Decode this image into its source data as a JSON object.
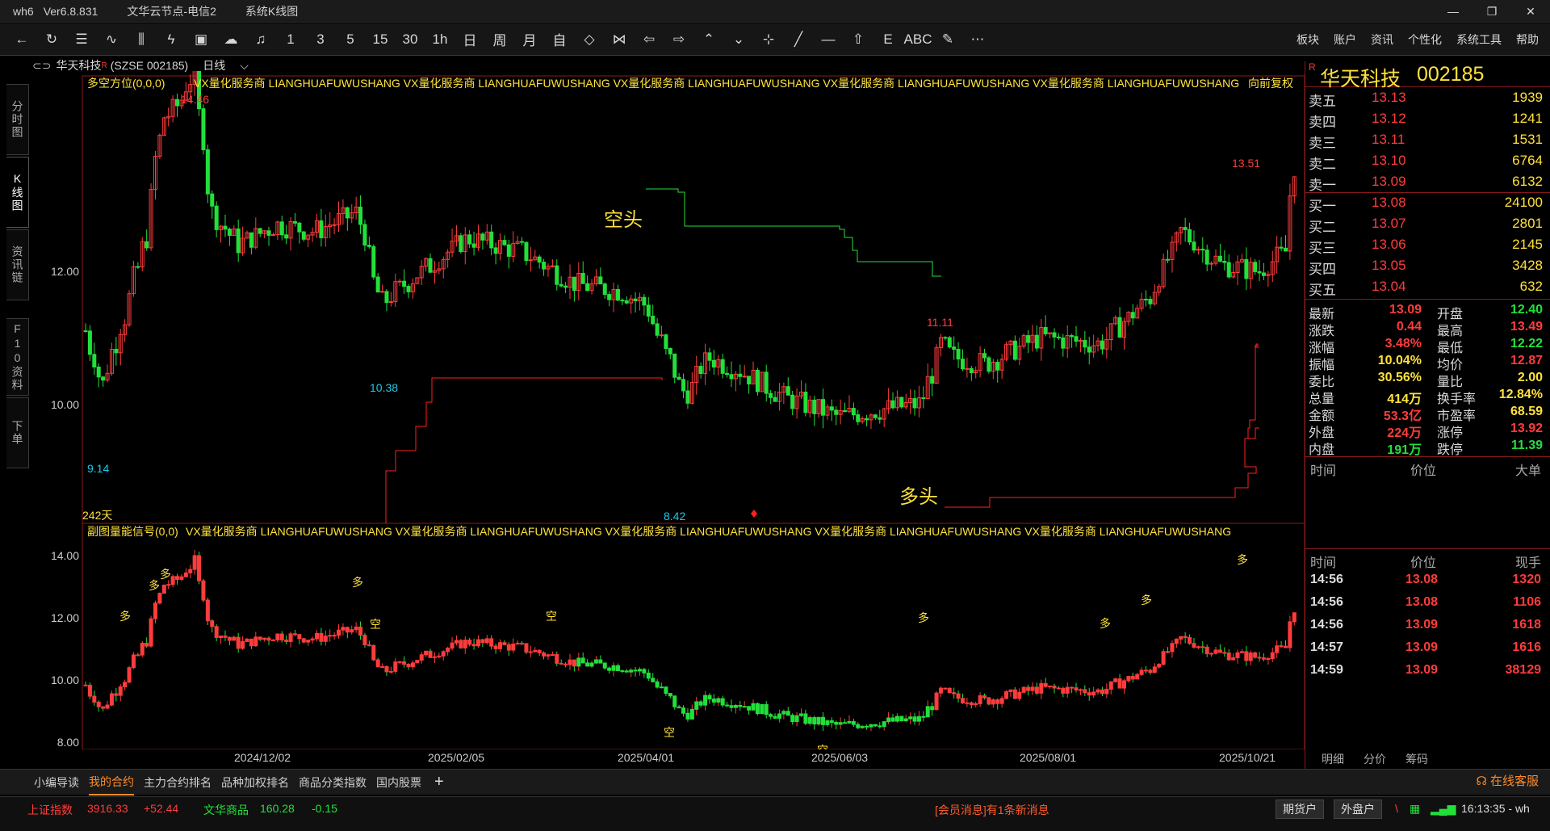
{
  "window": {
    "app": "wh6",
    "version": "Ver6.8.831",
    "server": "文华云节点-电信2",
    "view_title": "系统K线图",
    "controls": [
      "—",
      "❐",
      "✕"
    ]
  },
  "toolbar": {
    "buttons": [
      {
        "name": "back-icon",
        "glyph": "←"
      },
      {
        "name": "refresh-icon",
        "glyph": "↻"
      },
      {
        "name": "report-icon",
        "glyph": "☰"
      },
      {
        "name": "line-chart-icon",
        "glyph": "∿"
      },
      {
        "name": "bar-chart-icon",
        "glyph": "⫼"
      },
      {
        "name": "flash-icon",
        "glyph": "ϟ"
      },
      {
        "name": "board-icon",
        "glyph": "▣"
      },
      {
        "name": "cloud-icon",
        "glyph": "☁"
      },
      {
        "name": "bell-icon",
        "glyph": "♫"
      },
      {
        "name": "period-1",
        "glyph": "1"
      },
      {
        "name": "period-3",
        "glyph": "3"
      },
      {
        "name": "period-5",
        "glyph": "5"
      },
      {
        "name": "period-15",
        "glyph": "15"
      },
      {
        "name": "period-30",
        "glyph": "30"
      },
      {
        "name": "period-1h",
        "glyph": "1h"
      },
      {
        "name": "period-day",
        "glyph": "日"
      },
      {
        "name": "period-week",
        "glyph": "周"
      },
      {
        "name": "period-month",
        "glyph": "月"
      },
      {
        "name": "period-custom",
        "glyph": "自"
      },
      {
        "name": "zoom-in-icon",
        "glyph": "◇"
      },
      {
        "name": "zoom-out-icon",
        "glyph": "⋈"
      },
      {
        "name": "left-icon",
        "glyph": "⇦"
      },
      {
        "name": "right-icon",
        "glyph": "⇨"
      },
      {
        "name": "up-icon",
        "glyph": "⌃"
      },
      {
        "name": "down-icon",
        "glyph": "⌄"
      },
      {
        "name": "crosshair-icon",
        "glyph": "⊹"
      },
      {
        "name": "draw-line-icon",
        "glyph": "╱"
      },
      {
        "name": "hline-icon",
        "glyph": "—"
      },
      {
        "name": "home-icon",
        "glyph": "⇧"
      },
      {
        "name": "text-e-icon",
        "glyph": "E"
      },
      {
        "name": "abc-icon",
        "glyph": "ABC"
      },
      {
        "name": "pen-icon",
        "glyph": "✎"
      },
      {
        "name": "more-icon",
        "glyph": "⋯"
      }
    ],
    "menu": [
      "板块",
      "账户",
      "资讯",
      "个性化",
      "系统工具",
      "帮助"
    ]
  },
  "sidetabs": [
    "分时图",
    "K线图",
    "资讯链",
    "F10资料",
    "下单"
  ],
  "stock_header": {
    "name": "华天科技",
    "mark": "R",
    "code": "(SZSE 002185)",
    "period": "日线"
  },
  "main_chart": {
    "indicator": "多空方位(0,0,0)",
    "banner": "VX量化服务商  LIANGHUAFUWUSHANG  VX量化服务商  LIANGHUAFUWUSHANG  VX量化服务商  LIANGHUAFUWUSHANG  VX量化服务商  LIANGHUAFUWUSHANG  VX量化服务商  LIANGHUAFUWUSHANG",
    "adjust": "向前复权",
    "days": "242天",
    "y_labels": [
      "12.00",
      "10.00"
    ],
    "annotations": {
      "high": "14.46",
      "low1": "9.14",
      "low2": "10.38",
      "low3": "8.42",
      "peak2": "11.11",
      "last_high": "13.51"
    },
    "bear_label": "空头",
    "bull_label": "多头"
  },
  "sub_chart": {
    "indicator": "副图量能信号(0,0)",
    "banner": "VX量化服务商  LIANGHUAFUWUSHANG  VX量化服务商  LIANGHUAFUWUSHANG  VX量化服务商  LIANGHUAFUWUSHANG  VX量化服务商  LIANGHUAFUWUSHANG  VX量化服务商  LIANGHUAFUWUSHANG",
    "y_labels": [
      "14.00",
      "12.00",
      "10.00",
      "8.00"
    ],
    "signal_bull": "多",
    "signal_bear": "空"
  },
  "x_axis": [
    "2024/12/02",
    "2025/02/05",
    "2025/04/01",
    "2025/06/03",
    "2025/08/01",
    "2025/10/21"
  ],
  "quote": {
    "name": "华天科技",
    "code": "002185",
    "mark": "R",
    "asks": [
      {
        "label": "卖五",
        "price": "13.13",
        "vol": "1939"
      },
      {
        "label": "卖四",
        "price": "13.12",
        "vol": "1241"
      },
      {
        "label": "卖三",
        "price": "13.11",
        "vol": "1531"
      },
      {
        "label": "卖二",
        "price": "13.10",
        "vol": "6764"
      },
      {
        "label": "卖一",
        "price": "13.09",
        "vol": "6132"
      }
    ],
    "bids": [
      {
        "label": "买一",
        "price": "13.08",
        "vol": "24100"
      },
      {
        "label": "买二",
        "price": "13.07",
        "vol": "2801"
      },
      {
        "label": "买三",
        "price": "13.06",
        "vol": "2145"
      },
      {
        "label": "买四",
        "price": "13.05",
        "vol": "3428"
      },
      {
        "label": "买五",
        "price": "13.04",
        "vol": "632"
      }
    ],
    "stats": [
      {
        "l1": "最新",
        "v1": "13.09",
        "c1": "red",
        "l2": "开盘",
        "v2": "12.40",
        "c2": "grn"
      },
      {
        "l1": "涨跌",
        "v1": "0.44",
        "c1": "red",
        "l2": "最高",
        "v2": "13.49",
        "c2": "red"
      },
      {
        "l1": "涨幅",
        "v1": "3.48%",
        "c1": "red",
        "l2": "最低",
        "v2": "12.22",
        "c2": "grn"
      },
      {
        "l1": "振幅",
        "v1": "10.04%",
        "c1": "yel",
        "l2": "均价",
        "v2": "12.87",
        "c2": "red"
      },
      {
        "l1": "委比",
        "v1": "30.56%",
        "c1": "yel",
        "l2": "量比",
        "v2": "2.00",
        "c2": "yel"
      },
      {
        "l1": "总量",
        "v1": "414万",
        "c1": "yel",
        "l2": "换手率",
        "v2": "12.84%",
        "c2": "yel"
      },
      {
        "l1": "金额",
        "v1": "53.3亿",
        "c1": "red",
        "l2": "市盈率",
        "v2": "68.59",
        "c2": "yel"
      },
      {
        "l1": "外盘",
        "v1": "224万",
        "c1": "red",
        "l2": "涨停",
        "v2": "13.92",
        "c2": "red"
      },
      {
        "l1": "内盘",
        "v1": "191万",
        "c1": "grn",
        "l2": "跌停",
        "v2": "11.39",
        "c2": "grn"
      }
    ],
    "big_hdr": {
      "time": "时间",
      "price": "价位",
      "size": "大单"
    },
    "tick_hdr": {
      "time": "时间",
      "price": "价位",
      "size": "现手"
    },
    "ticks": [
      {
        "time": "14:56",
        "price": "13.08",
        "size": "1320"
      },
      {
        "time": "14:56",
        "price": "13.08",
        "size": "1106"
      },
      {
        "time": "14:56",
        "price": "13.09",
        "size": "1618"
      },
      {
        "time": "14:57",
        "price": "13.09",
        "size": "1616"
      },
      {
        "time": "14:59",
        "price": "13.09",
        "size": "38129"
      }
    ],
    "tabs": [
      "明细",
      "分价",
      "筹码"
    ]
  },
  "bottom_tabs": [
    "小编导读",
    "我的合约",
    "主力合约排名",
    "品种加权排名",
    "商品分类指数",
    "国内股票"
  ],
  "bottom_active": "我的合约",
  "service": "在线客服",
  "status": {
    "idx1_name": "上证指数",
    "idx1_val": "3916.33",
    "idx1_chg": "+52.44",
    "idx2_name": "文华商品",
    "idx2_val": "160.28",
    "idx2_chg": "-0.15",
    "msg": "[会员消息]有1条新消息",
    "btn1": "期货户",
    "btn2": "外盘户",
    "time": "16:13:35 - wh"
  },
  "colors": {
    "up": "#ff3c3c",
    "down": "#22e03a",
    "frame": "#8a1a1a",
    "label": "#ffe23a"
  }
}
